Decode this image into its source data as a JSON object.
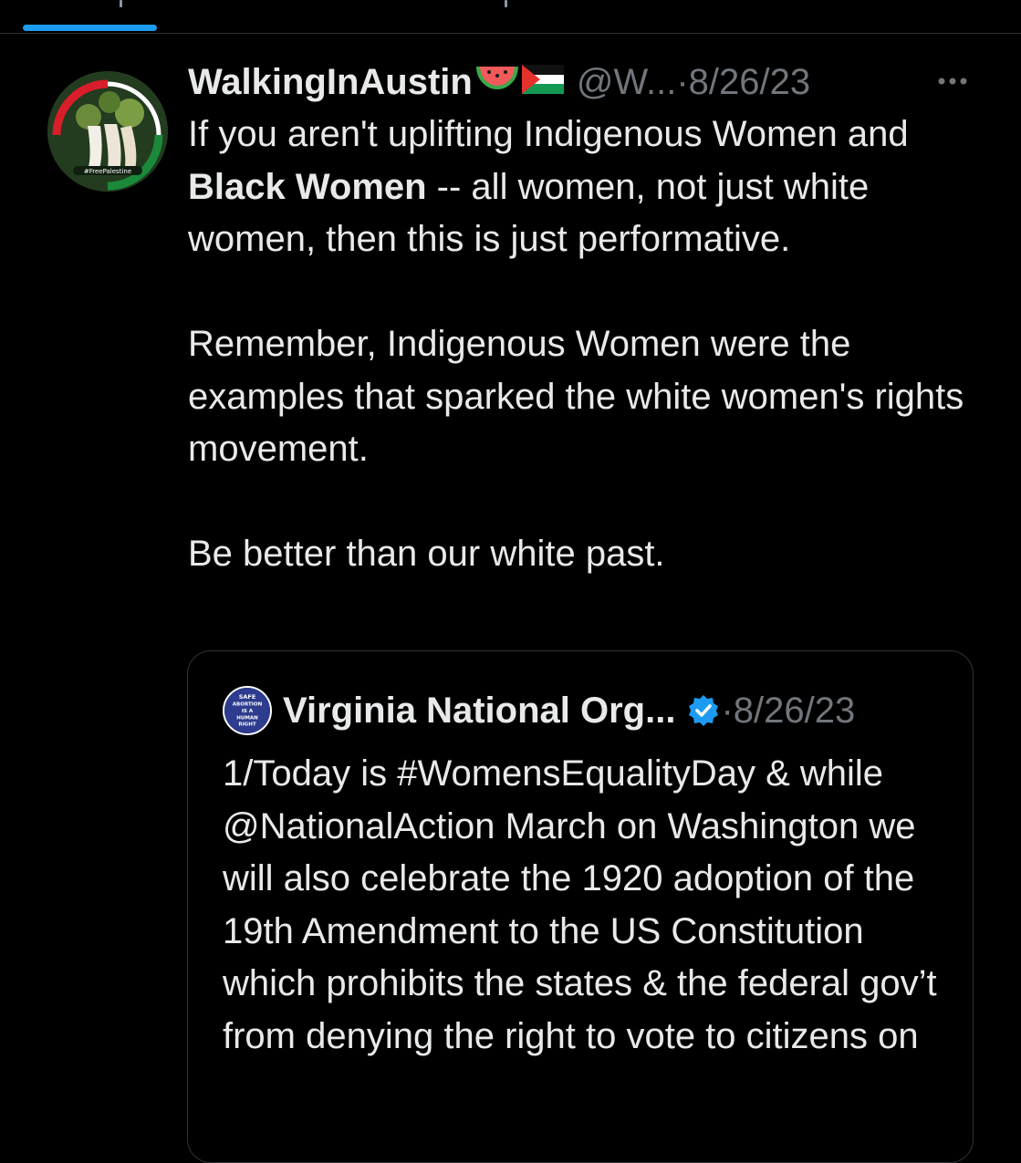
{
  "tweet": {
    "author": {
      "display_name": "WalkingInAustin",
      "emojis": [
        "watermelon-emoji",
        "palestine-flag-emoji"
      ],
      "avatar_caption": "#FreePalestine",
      "handle": "@W...",
      "separator": "·",
      "date": "8/26/23"
    },
    "more_icon": "more-horizontal-icon",
    "text": {
      "p1_before": "If you aren't uplifting Indigenous Women and ",
      "p1_bold": "Black Women",
      "p1_after": " -- all women, not just white women, then this is just performative.",
      "p2": "Remember, Indigenous Women were the examples that sparked the white women's rights movement.",
      "p3": "Be better than our white past."
    }
  },
  "quote": {
    "author": {
      "display_name": "Virginia National Org...",
      "verified_icon": "verified-badge-icon",
      "separator": "·",
      "date": "8/26/23",
      "avatar_text": [
        "SAFE",
        "ABORTION",
        "IS A",
        "HUMAN",
        "RIGHT"
      ]
    },
    "text": "1/Today is #WomensEqualityDay & while  @NationalAction March on Washington we will also celebrate the 1920 adoption of the 19th Amendment to the US Constitution which prohibits the states & the federal gov’t from denying the right to vote to citizens on"
  },
  "colors": {
    "background": "#000000",
    "text": "#e7e9ea",
    "muted": "#71767b",
    "accent": "#1d9bf0",
    "border": "#2f3336"
  }
}
